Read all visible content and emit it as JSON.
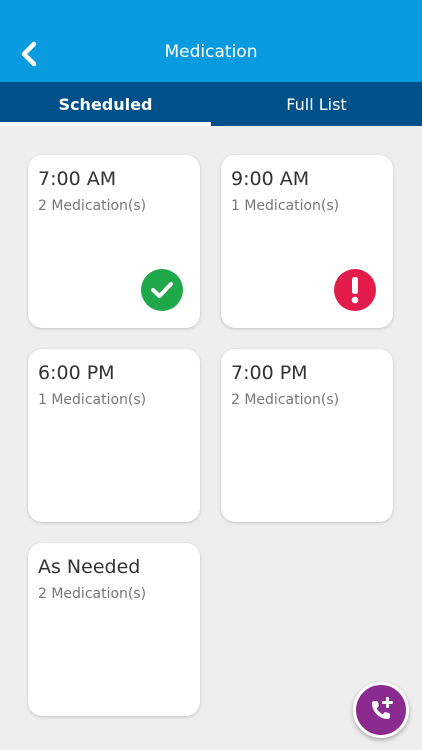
{
  "header": {
    "title": "Medication"
  },
  "tabs": [
    {
      "label": "Scheduled",
      "active": true
    },
    {
      "label": "Full List",
      "active": false
    }
  ],
  "cards": [
    {
      "time": "7:00 AM",
      "count": "2 Medication(s)",
      "status": "complete"
    },
    {
      "time": "9:00 AM",
      "count": "1 Medication(s)",
      "status": "missed"
    },
    {
      "time": "6:00 PM",
      "count": "1 Medication(s)",
      "status": "none"
    },
    {
      "time": "7:00 PM",
      "count": "2 Medication(s)",
      "status": "none"
    },
    {
      "time": "As Needed",
      "count": "2 Medication(s)",
      "status": "none"
    }
  ],
  "colors": {
    "header": "#0a9ae0",
    "tab_bar": "#00508a",
    "success": "#1ea84a",
    "alert": "#e31b4b",
    "fab": "#8c2b8f"
  },
  "icons": {
    "back": "chevron-left-icon",
    "complete": "check-circle-icon",
    "missed": "exclamation-circle-icon",
    "fab": "phone-plus-icon"
  }
}
